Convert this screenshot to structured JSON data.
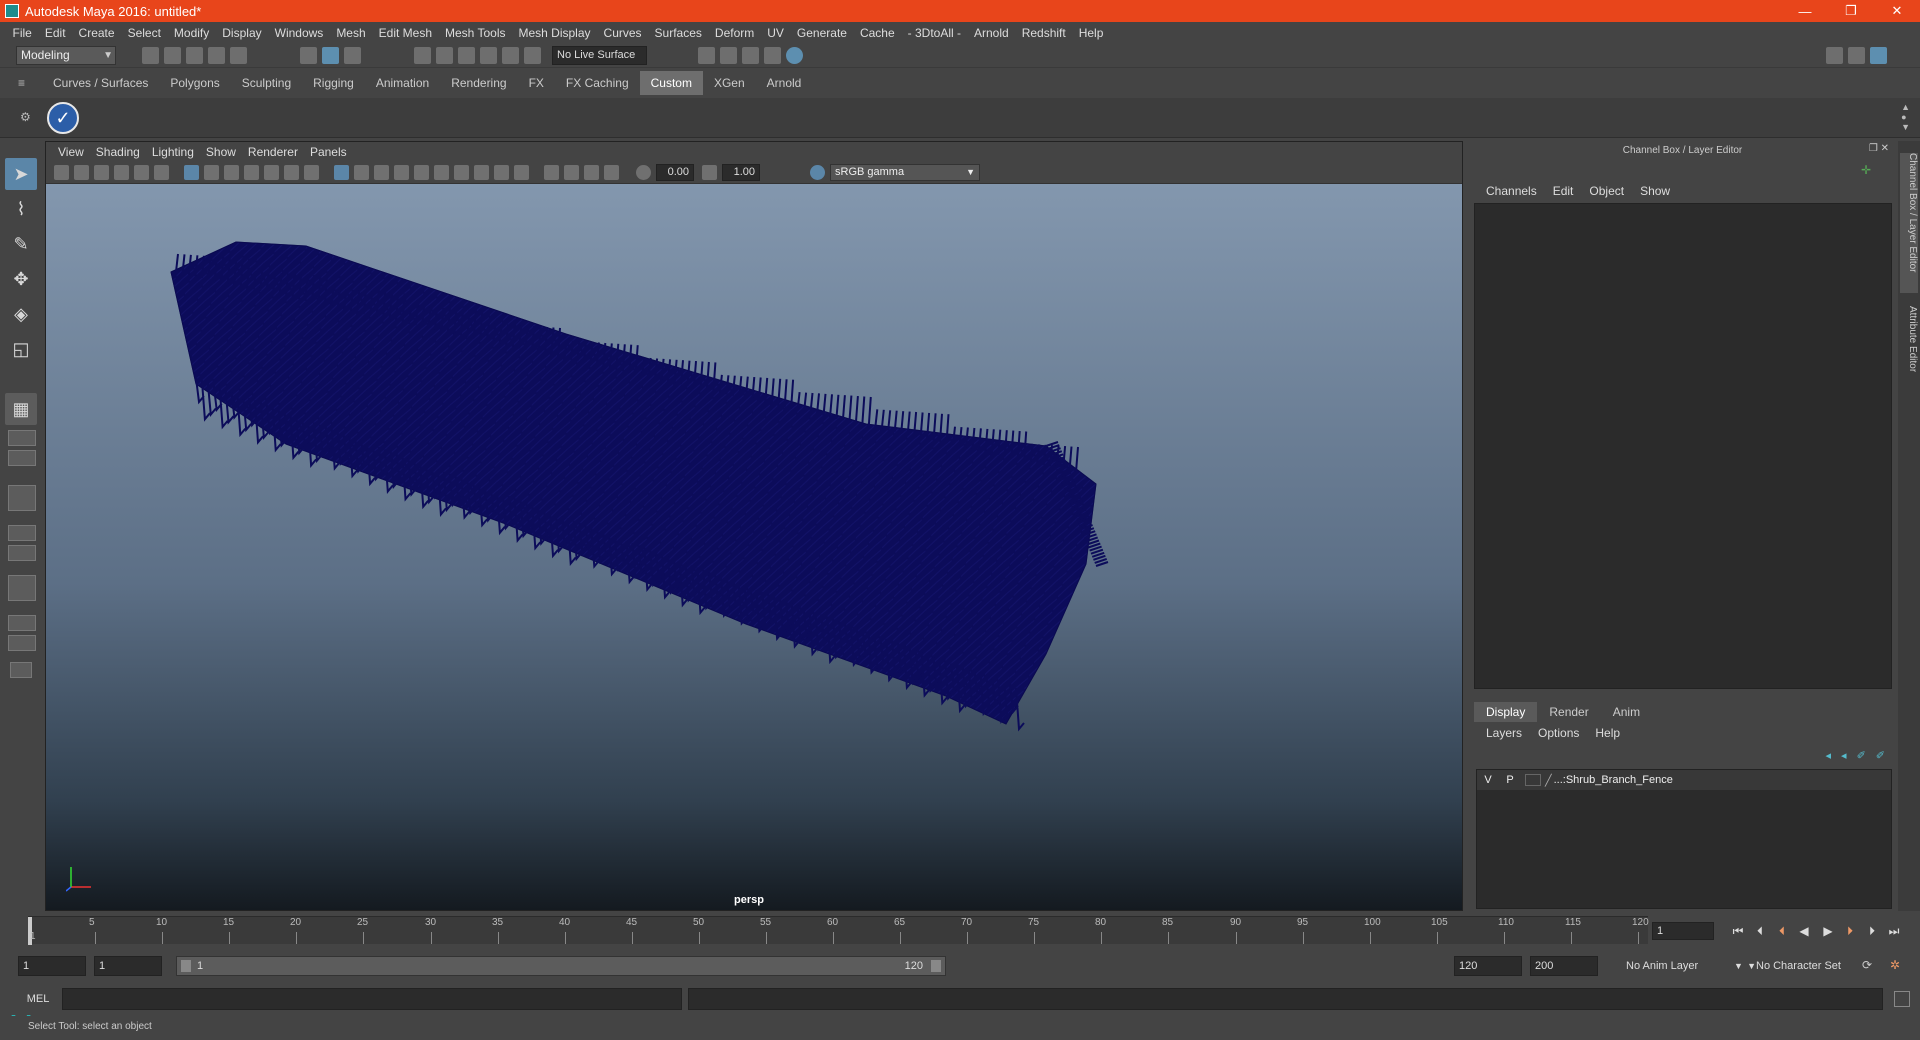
{
  "window": {
    "title": "Autodesk Maya 2016: untitled*",
    "minimize": "—",
    "restore": "❐",
    "close": "✕"
  },
  "menu": [
    "File",
    "Edit",
    "Create",
    "Select",
    "Modify",
    "Display",
    "Windows",
    "Mesh",
    "Edit Mesh",
    "Mesh Tools",
    "Mesh Display",
    "Curves",
    "Surfaces",
    "Deform",
    "UV",
    "Generate",
    "Cache",
    "- 3DtoAll -",
    "Arnold",
    "Redshift",
    "Help"
  ],
  "status_line": {
    "mode": "Modeling",
    "live_surface": "No Live Surface"
  },
  "shelf": {
    "tabs": [
      "Curves / Surfaces",
      "Polygons",
      "Sculpting",
      "Rigging",
      "Animation",
      "Rendering",
      "FX",
      "FX Caching",
      "Custom",
      "XGen",
      "Arnold"
    ],
    "active": "Custom"
  },
  "viewport": {
    "menu": [
      "View",
      "Shading",
      "Lighting",
      "Show",
      "Renderer",
      "Panels"
    ],
    "exposure": "0.00",
    "gamma": "1.00",
    "color_space": "sRGB gamma",
    "camera": "persp",
    "mesh_color": "#0c0c5a"
  },
  "channel_box": {
    "title": "Channel Box / Layer Editor",
    "menu": [
      "Channels",
      "Edit",
      "Object",
      "Show"
    ]
  },
  "layer_editor": {
    "tabs": [
      "Display",
      "Render",
      "Anim"
    ],
    "active": "Display",
    "menu": [
      "Layers",
      "Options",
      "Help"
    ],
    "layers": [
      {
        "v": "V",
        "p": "P",
        "name": "...:Shrub_Branch_Fence"
      }
    ]
  },
  "side_tabs": [
    "Channel Box / Layer Editor",
    "Attribute Editor"
  ],
  "timeline": {
    "start": "1",
    "ticks": [
      "5",
      "10",
      "15",
      "20",
      "25",
      "30",
      "35",
      "40",
      "45",
      "50",
      "55",
      "60",
      "65",
      "70",
      "75",
      "80",
      "85",
      "90",
      "95",
      "100",
      "105",
      "110",
      "115",
      "120"
    ],
    "current_frame": "1"
  },
  "range": {
    "start": "1",
    "anim_start": "1",
    "slider_start": "1",
    "slider_end": "120",
    "anim_end": "120",
    "end": "200",
    "anim_layer": "No Anim Layer",
    "char_set": "No Character Set"
  },
  "command": {
    "label": "MEL"
  },
  "help_line": "Select Tool: select an object",
  "colors": {
    "accent": "#e8451b",
    "selection": "#5b86a8"
  }
}
